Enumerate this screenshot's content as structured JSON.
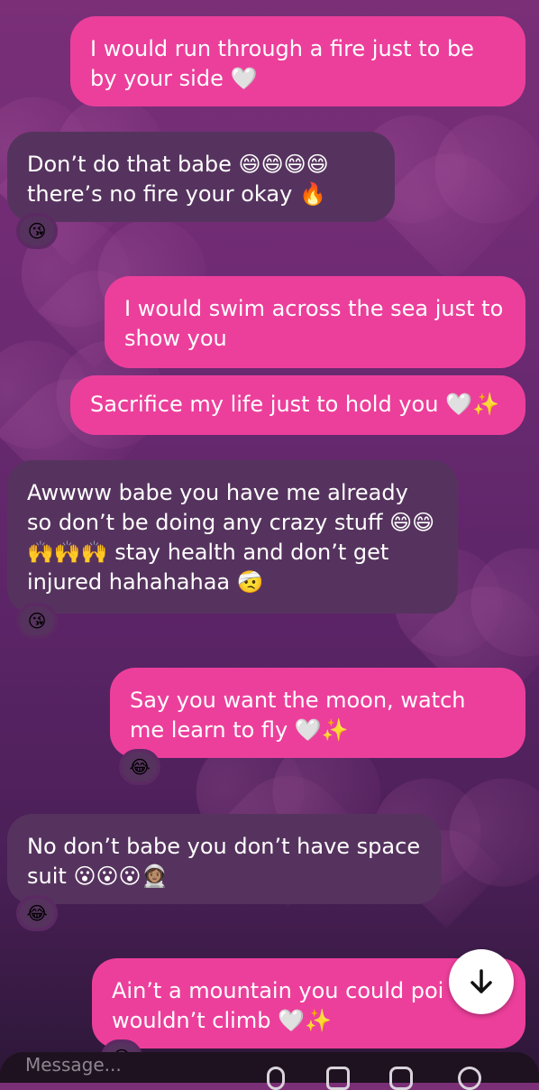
{
  "messages": [
    {
      "side": "sent",
      "text": "I would run through a fire just to be by your side",
      "emoji": "🤍"
    },
    {
      "side": "recv",
      "text": "Don’t do that babe",
      "emoji": "😄😄😄😄",
      "line2": "there’s no fire your okay",
      "emoji2": "🔥",
      "reaction": "😘"
    },
    {
      "side": "sent",
      "text": "I would swim across the sea just to show you"
    },
    {
      "side": "sent",
      "text": "Sacrifice my life just to hold you",
      "emoji": "🤍✨"
    },
    {
      "side": "recv",
      "text": "Awwww babe you have me already so don’t be doing any crazy stuff",
      "emoji": "😄😄",
      "line2": "🙌🙌🙌 stay health and don’t get injured hahahahaa",
      "emoji2": "🤕",
      "reaction": "😘"
    },
    {
      "side": "sent",
      "text": "Say you want the moon, watch me learn to fly",
      "emoji": "🤍✨",
      "reaction": "😂"
    },
    {
      "side": "recv",
      "text": "No don’t babe you don’t have space suit",
      "emoji": "😮😮😮👩🏽‍🚀",
      "reaction": "😂"
    },
    {
      "side": "sent",
      "text": "Ain’t a mountain you could poi",
      "line2": "wouldn’t climb",
      "emoji2": "🤍✨",
      "reaction": "😂"
    }
  ],
  "composer": {
    "placeholder": "Message..."
  },
  "icons": {
    "scroll": "arrow-down-icon",
    "mic": "mic-icon",
    "gallery": "gallery-icon",
    "sticker": "sticker-icon",
    "add": "add-icon"
  }
}
